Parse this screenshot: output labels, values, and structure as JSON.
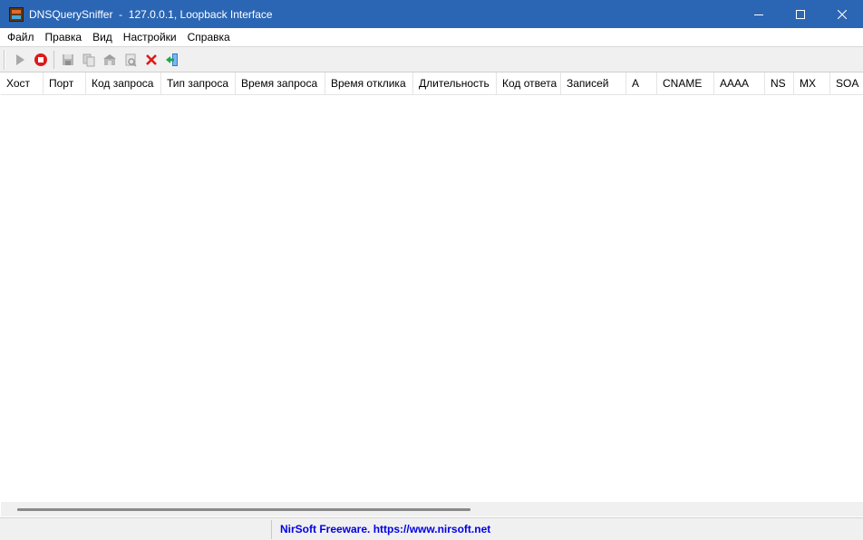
{
  "window": {
    "title": "DNSQuerySniffer  -  127.0.0.1, Loopback Interface",
    "minimize_icon": "minimize-icon",
    "maximize_icon": "maximize-icon",
    "close_icon": "close-icon"
  },
  "menu": {
    "items": [
      "Файл",
      "Правка",
      "Вид",
      "Настройки",
      "Справка"
    ]
  },
  "toolbar": {
    "buttons": [
      {
        "icon": "play-icon",
        "enabled": false
      },
      {
        "icon": "stop-icon",
        "enabled": true
      },
      {
        "icon": "save-icon",
        "enabled": false
      },
      {
        "icon": "copy-icon",
        "enabled": false
      },
      {
        "icon": "html-report-icon",
        "enabled": false
      },
      {
        "icon": "properties-icon",
        "enabled": false
      },
      {
        "icon": "clear-icon",
        "enabled": true
      },
      {
        "icon": "exit-icon",
        "enabled": true
      }
    ],
    "colors": {
      "stop": "#e01818",
      "clear": "#e01818",
      "exit_blue": "#2b7bd6",
      "exit_green": "#1ea64a"
    }
  },
  "table": {
    "columns": [
      "Хост",
      "Порт",
      "Код запроса",
      "Тип запроса",
      "Время запроса",
      "Время отклика",
      "Длительность",
      "Код ответа",
      "Записей",
      "A",
      "CNAME",
      "AAAA",
      "NS",
      "MX",
      "SOA"
    ],
    "rows": []
  },
  "status": {
    "link_text": "NirSoft Freeware. https://www.nirsoft.net",
    "link_color": "#0000e6"
  }
}
